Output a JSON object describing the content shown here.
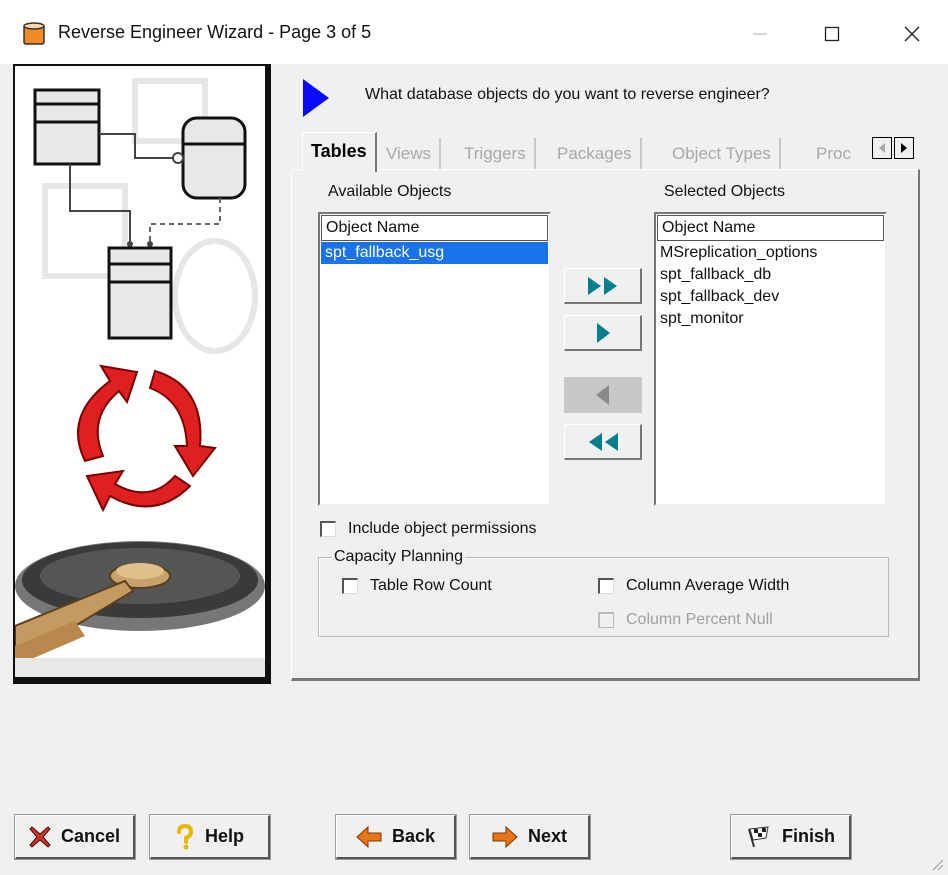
{
  "window": {
    "title": "Reverse Engineer Wizard - Page 3 of 5"
  },
  "prompt": "What database objects do you want to reverse engineer?",
  "tabs": [
    {
      "label": "Tables",
      "active": true
    },
    {
      "label": "Views",
      "active": false
    },
    {
      "label": "Triggers",
      "active": false
    },
    {
      "label": "Packages",
      "active": false
    },
    {
      "label": "Object Types",
      "active": false
    },
    {
      "label": "Proc",
      "active": false
    }
  ],
  "available": {
    "label": "Available Objects",
    "column_header": "Object Name",
    "items": [
      "spt_fallback_usg"
    ],
    "selected_index": 0
  },
  "selected": {
    "label": "Selected Objects",
    "column_header": "Object Name",
    "items": [
      "MSreplication_options",
      "spt_fallback_db",
      "spt_fallback_dev",
      "spt_monitor"
    ]
  },
  "options": {
    "include_permissions": "Include object permissions",
    "capacity_group": "Capacity Planning",
    "table_row_count": "Table Row Count",
    "column_avg_width": "Column Average Width",
    "column_percent_null": "Column Percent Null"
  },
  "buttons": {
    "cancel": "Cancel",
    "help": "Help",
    "back": "Back",
    "next": "Next",
    "finish": "Finish"
  },
  "colors": {
    "accent": "#0a0aff",
    "move_arrow": "#00808a",
    "selection": "#1a73e8",
    "cancel_x": "#c0392b",
    "nav_arrow": "#e8741a"
  }
}
